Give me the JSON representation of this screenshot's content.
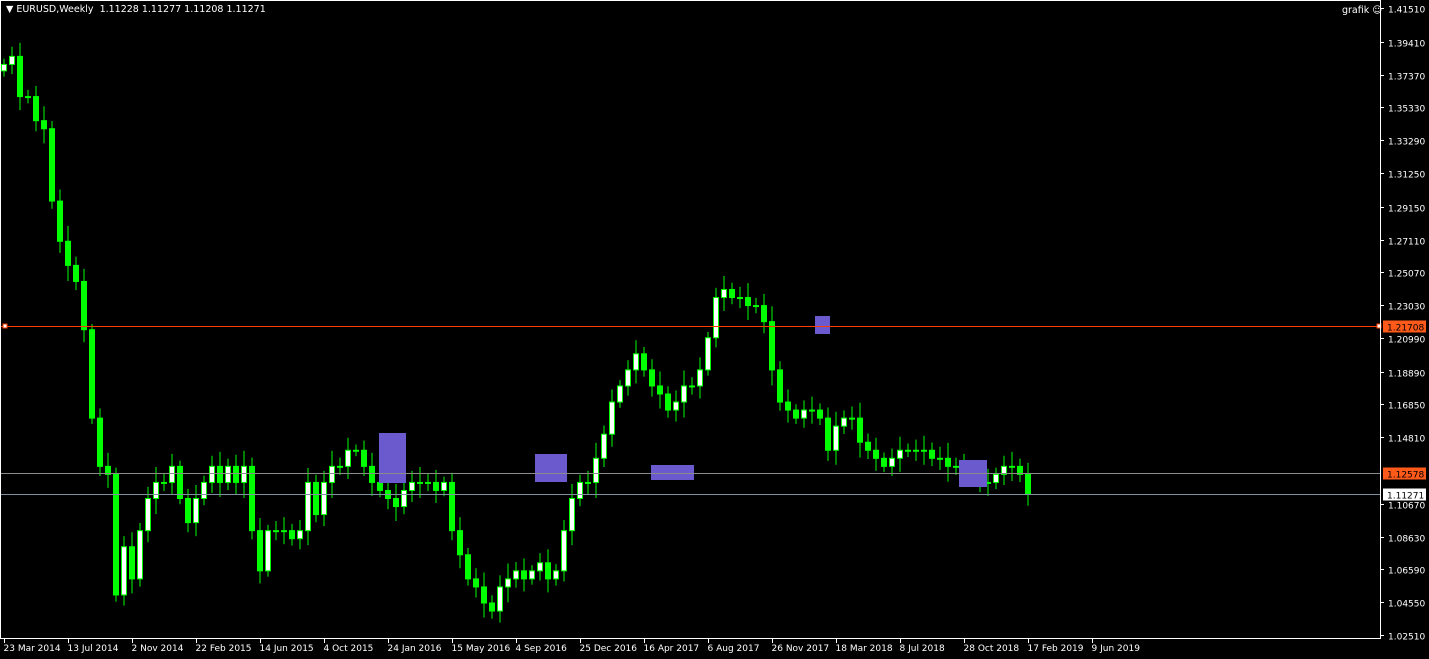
{
  "header": {
    "symbol": "EURUSD,Weekly",
    "ohlc": "1.11228 1.11277 1.11208 1.11271",
    "expert_label": "grafik",
    "expert_icon": "smiley-icon"
  },
  "colors": {
    "bg": "#000000",
    "candle": "#00ff00",
    "candle_fill": "#ffffff",
    "axis": "#ffffff",
    "hline_red": "#ff3b00",
    "hline_level": "#ff5a1a",
    "bid_line": "#8090a0",
    "box": "#6a5acd"
  },
  "chart_data": {
    "type": "candlestick",
    "title": "EURUSD,Weekly",
    "ylim": [
      1.0251,
      1.4151
    ],
    "y_ticks": [
      "1.41510",
      "1.39410",
      "1.37370",
      "1.35330",
      "1.33290",
      "1.31250",
      "1.29150",
      "1.27110",
      "1.25070",
      "1.23030",
      "1.20990",
      "1.18890",
      "1.16850",
      "1.14810",
      "1.10670",
      "1.08630",
      "1.06590",
      "1.04550",
      "1.02510"
    ],
    "x_ticks": [
      "23 Mar 2014",
      "13 Jul 2014",
      "2 Nov 2014",
      "22 Feb 2015",
      "14 Jun 2015",
      "4 Oct 2015",
      "24 Jan 2016",
      "15 May 2016",
      "4 Sep 2016",
      "25 Dec 2016",
      "16 Apr 2017",
      "6 Aug 2017",
      "26 Nov 2017",
      "18 Mar 2018",
      "8 Jul 2018",
      "28 Oct 2018",
      "17 Feb 2019",
      "9 Jun 2019"
    ],
    "period_weeks_per_close": 2,
    "closes": [
      1.38,
      1.385,
      1.36,
      1.36,
      1.345,
      1.34,
      1.295,
      1.27,
      1.255,
      1.245,
      1.215,
      1.16,
      1.13,
      1.125,
      1.05,
      1.08,
      1.06,
      1.09,
      1.11,
      1.12,
      1.12,
      1.13,
      1.11,
      1.095,
      1.11,
      1.12,
      1.13,
      1.12,
      1.13,
      1.12,
      1.13,
      1.09,
      1.065,
      1.09,
      1.09,
      1.09,
      1.085,
      1.09,
      1.12,
      1.1,
      1.12,
      1.13,
      1.13,
      1.14,
      1.14,
      1.13,
      1.12,
      1.115,
      1.11,
      1.105,
      1.115,
      1.12,
      1.12,
      1.12,
      1.115,
      1.12,
      1.09,
      1.075,
      1.06,
      1.055,
      1.045,
      1.04,
      1.055,
      1.06,
      1.065,
      1.06,
      1.065,
      1.07,
      1.06,
      1.065,
      1.09,
      1.11,
      1.12,
      1.12,
      1.135,
      1.15,
      1.17,
      1.18,
      1.19,
      1.2,
      1.19,
      1.18,
      1.175,
      1.165,
      1.17,
      1.18,
      1.18,
      1.19,
      1.21,
      1.235,
      1.24,
      1.235,
      1.235,
      1.23,
      1.23,
      1.22,
      1.19,
      1.17,
      1.165,
      1.16,
      1.165,
      1.165,
      1.16,
      1.14,
      1.155,
      1.16,
      1.16,
      1.145,
      1.14,
      1.135,
      1.13,
      1.135,
      1.14,
      1.14,
      1.14,
      1.14,
      1.135,
      1.135,
      1.13,
      1.13,
      1.13,
      1.125,
      1.12,
      1.12,
      1.125,
      1.13,
      1.13,
      1.125,
      1.11271
    ],
    "hlines": [
      {
        "value": 1.21708,
        "label": "1.21708",
        "kind": "red"
      },
      {
        "value": 1.12578,
        "label": "1.12578",
        "kind": "level"
      },
      {
        "value": 1.11271,
        "label": "1.11271",
        "kind": "bid"
      }
    ]
  }
}
